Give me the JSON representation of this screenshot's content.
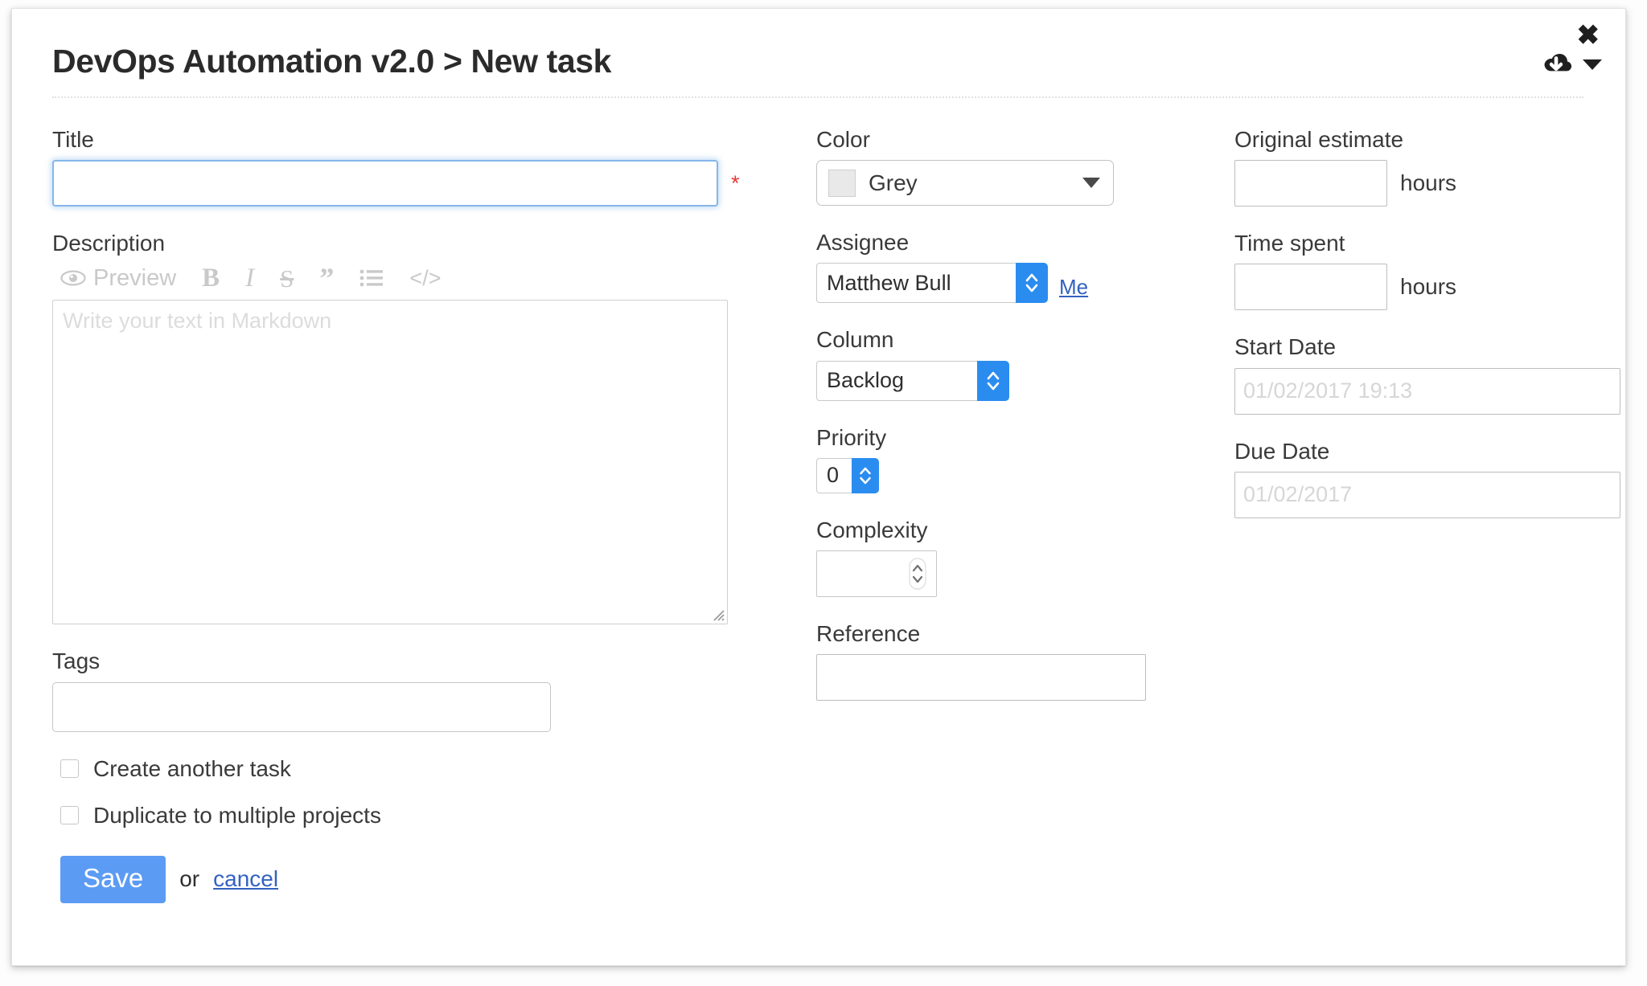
{
  "header": {
    "title": "DevOps Automation v2.0 > New task",
    "close_icon": "close-icon",
    "cloud_icon": "cloud-download-icon",
    "cloud_caret_icon": "chevron-down-icon"
  },
  "form": {
    "title": {
      "label": "Title",
      "value": "",
      "placeholder": "",
      "required_marker": "*"
    },
    "description": {
      "label": "Description",
      "value": "",
      "placeholder": "Write your text in Markdown",
      "toolbar": {
        "preview_label": "Preview",
        "preview_icon": "eye-icon",
        "bold": "B",
        "italic": "I",
        "strikethrough": "S",
        "quote": "”",
        "list_icon": "bullet-list-icon",
        "code": "</>"
      }
    },
    "tags": {
      "label": "Tags",
      "value": "",
      "placeholder": ""
    },
    "checkboxes": [
      {
        "label": "Create another task",
        "checked": false
      },
      {
        "label": "Duplicate to multiple projects",
        "checked": false
      }
    ],
    "color": {
      "label": "Color",
      "selected": "Grey",
      "swatch_hex": "#e9e9e9",
      "caret_icon": "caret-down-icon"
    },
    "assignee": {
      "label": "Assignee",
      "selected": "Matthew Bull",
      "me_link": "Me"
    },
    "column": {
      "label": "Column",
      "selected": "Backlog"
    },
    "priority": {
      "label": "Priority",
      "selected": "0"
    },
    "complexity": {
      "label": "Complexity",
      "value": "",
      "placeholder": ""
    },
    "reference": {
      "label": "Reference",
      "value": "",
      "placeholder": ""
    },
    "original_estimate": {
      "label": "Original estimate",
      "value": "",
      "placeholder": "",
      "unit": "hours"
    },
    "time_spent": {
      "label": "Time spent",
      "value": "",
      "placeholder": "",
      "unit": "hours"
    },
    "start_date": {
      "label": "Start Date",
      "value": "",
      "placeholder": "01/02/2017 19:13"
    },
    "due_date": {
      "label": "Due Date",
      "value": "",
      "placeholder": "01/02/2017"
    }
  },
  "actions": {
    "save_label": "Save",
    "or_label": "or",
    "cancel_label": "cancel",
    "save_color": "#5b9bf4",
    "link_color": "#3461c1",
    "accent_blue": "#2b8cf0",
    "required_color": "#e53935"
  }
}
